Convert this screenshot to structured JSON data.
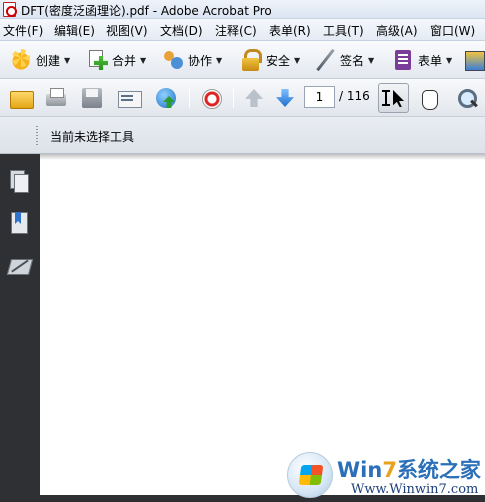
{
  "window": {
    "title": "DFT(密度泛函理论).pdf - Adobe Acrobat Pro"
  },
  "menubar": {
    "items": [
      "文件(F)",
      "编辑(E)",
      "视图(V)",
      "文档(D)",
      "注释(C)",
      "表单(R)",
      "工具(T)",
      "高级(A)",
      "窗口(W)"
    ]
  },
  "tasks_toolbar": {
    "items": [
      {
        "label": "创建",
        "icon": "create-icon"
      },
      {
        "label": "合并",
        "icon": "combine-icon"
      },
      {
        "label": "协作",
        "icon": "collaborate-icon"
      },
      {
        "label": "安全",
        "icon": "lock-icon"
      },
      {
        "label": "签名",
        "icon": "pen-icon"
      },
      {
        "label": "表单",
        "icon": "form-icon"
      }
    ]
  },
  "file_toolbar": {
    "page_number": "1",
    "page_total": "/ 116",
    "icons": [
      "open-folder-icon",
      "print-icon",
      "save-icon",
      "email-icon",
      "web-upload-icon",
      "review-icon",
      "previous-page-icon",
      "next-page-icon",
      "select-tool-icon",
      "hand-tool-icon",
      "zoom-icon"
    ]
  },
  "properties_bar": {
    "label": "当前未选择工具"
  },
  "navigation_pane": {
    "icons": [
      "pages-icon",
      "bookmarks-icon",
      "signatures-icon"
    ]
  },
  "watermark": {
    "title_main": "Win",
    "title_digit": "7",
    "title_tail": "系统之家",
    "url": "Www.Winwin7.com"
  }
}
